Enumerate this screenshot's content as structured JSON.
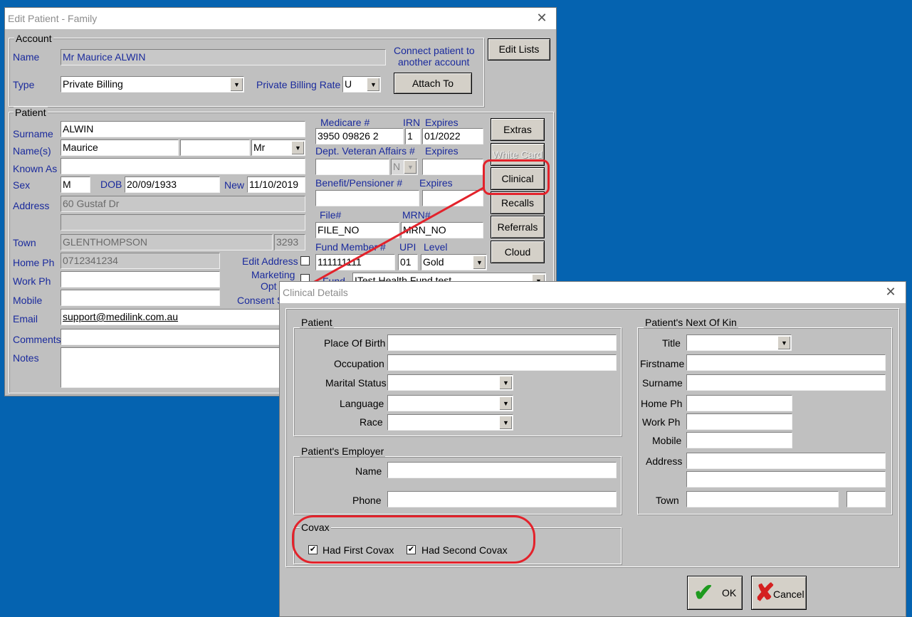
{
  "edit_window": {
    "title": "Edit Patient - Family",
    "close": "✕",
    "account": {
      "legend": "Account",
      "name_label": "Name",
      "name_value": "Mr Maurice ALWIN",
      "type_label": "Type",
      "type_value": "Private Billing",
      "connect_text_1": "Connect patient to",
      "connect_text_2": "another account",
      "rate_label": "Private Billing Rate",
      "rate_value": "U",
      "attach_button": "Attach To"
    },
    "edit_lists_button": "Edit Lists",
    "patient": {
      "legend": "Patient",
      "surname_label": "Surname",
      "surname_value": "ALWIN",
      "names_label": "Name(s)",
      "first_name_value": "Maurice",
      "middle_name_value": "",
      "title_value": "Mr",
      "known_as_label": "Known As",
      "sex_label": "Sex",
      "sex_value": "M",
      "dob_label": "DOB",
      "dob_value": "20/09/1933",
      "new_label": "New",
      "new_value": "11/10/2019",
      "address_label": "Address",
      "address_1": "60 Gustaf Dr",
      "town_label": "Town",
      "town_value": "GLENTHOMPSON",
      "postcode_value": "3293",
      "home_ph_label": "Home Ph",
      "home_ph_value": "0712341234",
      "work_ph_label": "Work Ph",
      "mobile_label": "Mobile",
      "email_label": "Email",
      "email_value": "support@medilink.com.au",
      "comments_label": "Comments",
      "notes_label": "Notes",
      "edit_address_label": "Edit Address",
      "marketing_label_1": "Marketing",
      "marketing_label_2": "Opt I",
      "consent_label": "Consent S",
      "medicare_label": "Medicare #",
      "medicare_value": "3950 09826 2",
      "irn_label": "IRN",
      "irn_value": "1",
      "expires_label": "Expires",
      "medicare_expires_value": "01/2022",
      "dva_label": "Dept. Veteran Affairs #",
      "dva_expires_label": "Expires",
      "dva_type_value": "N",
      "benefit_label": "Benefit/Pensioner #",
      "benefit_expires_label": "Expires",
      "file_label": "File#",
      "file_value": "FILE_NO",
      "mrn_label": "MRN#",
      "mrn_value": "MRN_NO",
      "fund_member_label": "Fund Member #",
      "fund_member_value": "111111111",
      "upi_label": "UPI",
      "upi_value": "01",
      "level_label": "Level",
      "level_value": "Gold",
      "fund_label": "Fund",
      "fund_value": "ITest Health Fund test"
    },
    "side_buttons": {
      "extras": "Extras",
      "white_card": "White Card",
      "clinical": "Clinical",
      "recalls": "Recalls",
      "referrals": "Referrals",
      "cloud": "Cloud"
    }
  },
  "clinical_window": {
    "title": "Clinical Details",
    "close": "✕",
    "patient_group": {
      "legend": "Patient",
      "place_of_birth_label": "Place Of Birth",
      "occupation_label": "Occupation",
      "marital_status_label": "Marital Status",
      "language_label": "Language",
      "race_label": "Race"
    },
    "employer_group": {
      "legend": "Patient's Employer",
      "name_label": "Name",
      "phone_label": "Phone"
    },
    "covax_group": {
      "legend": "Covax",
      "first_label": "Had First Covax",
      "first_checked": true,
      "second_label": "Had Second Covax",
      "second_checked": true,
      "check_mark": "✔"
    },
    "nok_group": {
      "legend": "Patient's Next Of Kin",
      "title_label": "Title",
      "firstname_label": "Firstname",
      "surname_label": "Surname",
      "home_ph_label": "Home Ph",
      "work_ph_label": "Work Ph",
      "mobile_label": "Mobile",
      "address_label": "Address",
      "town_label": "Town"
    },
    "ok_button": "OK",
    "cancel_button": "Cancel"
  },
  "colors": {
    "desktop": "#0563b0",
    "window": "#c0c0c0",
    "highlight": "#e3222b",
    "label_blue": "#1a2a9c"
  }
}
